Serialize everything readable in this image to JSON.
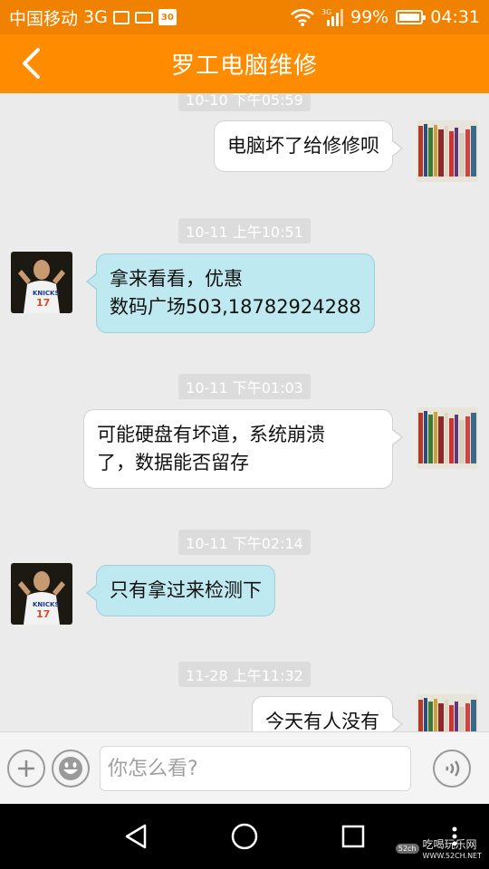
{
  "status_bar": {
    "carrier": "中国移动",
    "network": "3G",
    "calendar_day": "30",
    "battery": "99%",
    "time": "04:31",
    "icons": [
      "gallery-icon",
      "keyboard-icon",
      "calendar-icon",
      "wifi-icon",
      "signal-icon",
      "battery-icon"
    ]
  },
  "header": {
    "title": "罗工电脑维修",
    "back_icon": "chevron-left-icon"
  },
  "messages": [
    {
      "type": "timestamp",
      "text": "10-10 下午05:59"
    },
    {
      "type": "outgoing",
      "text": "电脑坏了给修修呗"
    },
    {
      "type": "timestamp",
      "text": "10-11 上午10:51"
    },
    {
      "type": "incoming",
      "lines": [
        "拿来看看，优惠",
        "数码广场503,18782924288"
      ]
    },
    {
      "type": "timestamp",
      "text": "10-11 下午01:03"
    },
    {
      "type": "outgoing",
      "lines": [
        "可能硬盘有坏道，系统崩溃",
        "了，数据能否留存"
      ]
    },
    {
      "type": "timestamp",
      "text": "10-11 下午02:14"
    },
    {
      "type": "incoming",
      "text": "只有拿过来检测下"
    },
    {
      "type": "timestamp",
      "text": "11-28 上午11:32"
    },
    {
      "type": "outgoing",
      "text": "今天有人没有"
    }
  ],
  "input_bar": {
    "placeholder": "你怎么看?",
    "buttons": [
      "plus-icon",
      "emoji-icon",
      "voice-icon"
    ]
  },
  "nav_bar": {
    "buttons": [
      "back-triangle-icon",
      "home-circle-icon",
      "recents-square-icon"
    ],
    "watermark_logo": "52ch",
    "watermark_text": "吃喝玩乐网",
    "watermark_url": "WWW.52CH.NET"
  },
  "colors": {
    "header": "#ff8c00",
    "incoming_bubble": "#bfe9f0",
    "outgoing_bubble": "#ffffff",
    "background": "#ebebeb"
  }
}
